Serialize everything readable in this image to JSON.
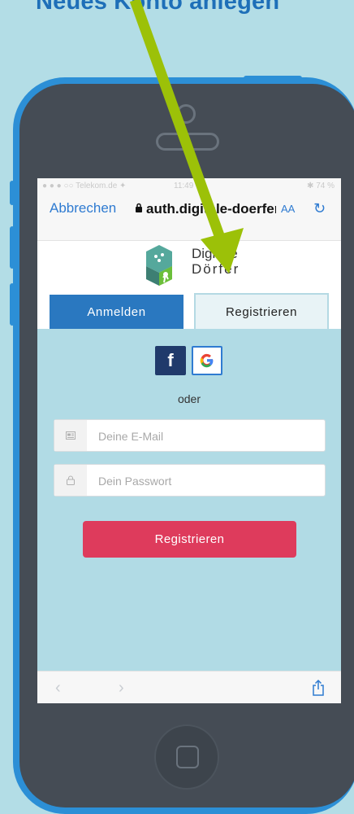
{
  "headline": "Neues Konto anlegen",
  "status": {
    "carrier": "● ● ● ○○ Telekom.de ✦",
    "time": "11:49",
    "battery": "✱ 74 %"
  },
  "browser": {
    "cancel_label": "Abbrechen",
    "url": "auth.digitale-doerfer.de",
    "text_size_label": "AA",
    "lock_icon": "lock-icon",
    "reload_icon": "reload-icon",
    "share_icon": "share-icon"
  },
  "logo": {
    "line1": "Digitale",
    "line2": "Dörfer"
  },
  "tabs": {
    "login": "Anmelden",
    "register": "Registrieren"
  },
  "social": {
    "facebook": "f",
    "google": "G"
  },
  "divider_text": "oder",
  "form": {
    "email_placeholder": "Deine E-Mail",
    "password_placeholder": "Dein Passwort",
    "submit_label": "Registrieren"
  },
  "colors": {
    "accent_blue": "#2a78c0",
    "submit_red": "#de3b5c",
    "panel_bg": "#b1dbe5",
    "annotation_arrow": "#9cc108"
  }
}
